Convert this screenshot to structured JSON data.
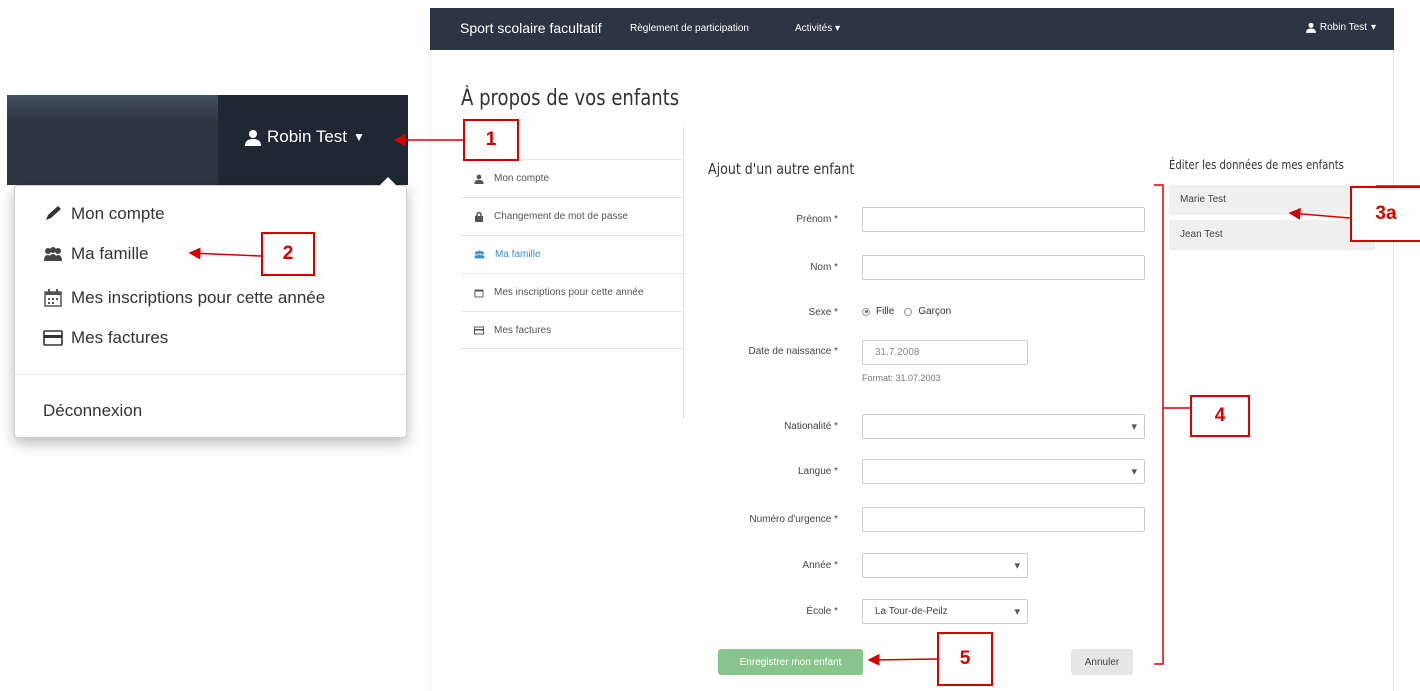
{
  "inset": {
    "user_name": "Robin Test",
    "dropdown": [
      {
        "label": "Mon compte",
        "icon": "pencil-icon"
      },
      {
        "label": "Ma famille",
        "icon": "family-icon"
      },
      {
        "label": "Mes inscriptions pour cette année",
        "icon": "calendar-icon"
      },
      {
        "label": "Mes factures",
        "icon": "credit-card-icon"
      }
    ],
    "logout": "Déconnexion"
  },
  "navbar": {
    "brand": "Sport scolaire facultatif",
    "rules": "Règlement de participation",
    "activities": "Activités",
    "user": "Robin Test"
  },
  "page": {
    "title": "À propos de vos enfants"
  },
  "side_menu": [
    {
      "label": "Mon compte",
      "icon": "user-icon",
      "active": false
    },
    {
      "label": "Changement de mot de passe",
      "icon": "lock-icon",
      "active": false
    },
    {
      "label": "Ma famille",
      "icon": "family-icon",
      "active": true
    },
    {
      "label": "Mes inscriptions pour cette année",
      "icon": "calendar-icon",
      "active": false
    },
    {
      "label": "Mes factures",
      "icon": "credit-card-icon",
      "active": false
    }
  ],
  "form": {
    "heading": "Ajout d'un autre enfant",
    "prenom_label": "Prénom *",
    "nom_label": "Nom *",
    "sexe_label": "Sexe *",
    "sexe_fille": "Fille",
    "sexe_garcon": "Garçon",
    "birthdate_label": "Date de naissance *",
    "birthdate_placeholder": "31.7.2008",
    "birthdate_hint": "Format: 31.07.2003",
    "nationalite_label": "Nationalité *",
    "langue_label": "Langue *",
    "urgence_label": "Numéro d'urgence *",
    "annee_label": "Année *",
    "ecole_label": "École *",
    "ecole_value": "La Tour-de-Peilz",
    "save": "Enregistrer mon enfant",
    "cancel": "Annuler"
  },
  "children": {
    "heading": "Éditer les données de mes enfants",
    "items": [
      "Marie Test",
      "Jean Test"
    ]
  },
  "annotations": [
    "1",
    "2",
    "3a",
    "4",
    "5"
  ],
  "colors": {
    "navbar": "#2b3543",
    "accent": "#3b8ed3",
    "save": "#88c48c",
    "annotation": "#d60000"
  }
}
